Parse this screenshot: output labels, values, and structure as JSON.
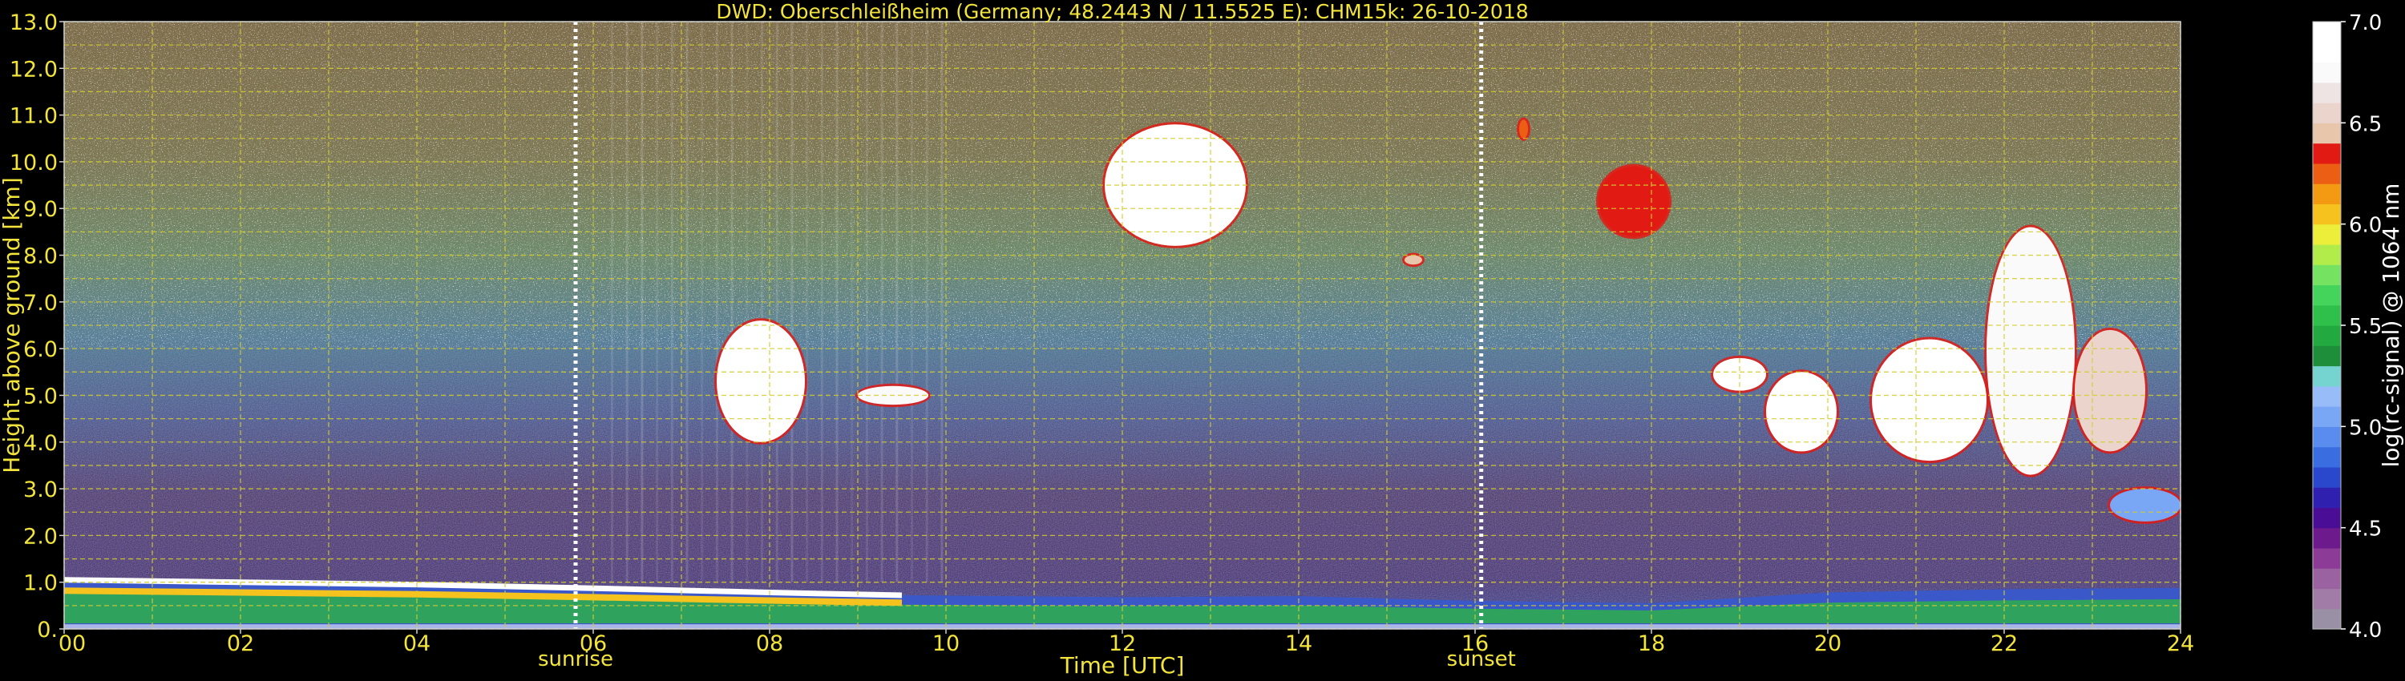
{
  "chart_data": {
    "type": "heatmap",
    "title": "DWD: Oberschleißheim (Germany; 48.2443 N / 11.5525 E):    CHM15k: 26-10-2018",
    "xlabel": "Time [UTC]",
    "ylabel": "Height above ground [km]",
    "colorbar_label": "log(rc-signal) @ 1064 nm",
    "xlim": [
      0,
      24
    ],
    "ylim": [
      0,
      13
    ],
    "x_ticks": [
      {
        "value": 0,
        "label": "00"
      },
      {
        "value": 2,
        "label": "02"
      },
      {
        "value": 4,
        "label": "04"
      },
      {
        "value": 6,
        "label": "06"
      },
      {
        "value": 8,
        "label": "08"
      },
      {
        "value": 10,
        "label": "10"
      },
      {
        "value": 12,
        "label": "12"
      },
      {
        "value": 14,
        "label": "14"
      },
      {
        "value": 16,
        "label": "16"
      },
      {
        "value": 18,
        "label": "18"
      },
      {
        "value": 20,
        "label": "20"
      },
      {
        "value": 22,
        "label": "22"
      },
      {
        "value": 24,
        "label": "24"
      }
    ],
    "y_ticks": [
      {
        "value": 0,
        "label": "0."
      },
      {
        "value": 1,
        "label": "1.0"
      },
      {
        "value": 2,
        "label": "2.0"
      },
      {
        "value": 3,
        "label": "3.0"
      },
      {
        "value": 4,
        "label": "4.0"
      },
      {
        "value": 5,
        "label": "5.0"
      },
      {
        "value": 6,
        "label": "6.0"
      },
      {
        "value": 7,
        "label": "7.0"
      },
      {
        "value": 8,
        "label": "8.0"
      },
      {
        "value": 9,
        "label": "9.0"
      },
      {
        "value": 10,
        "label": "10.0"
      },
      {
        "value": 11,
        "label": "11.0"
      },
      {
        "value": 12,
        "label": "12.0"
      },
      {
        "value": 13,
        "label": "13.0"
      }
    ],
    "x_grid": [
      1,
      3,
      5,
      7,
      9,
      11,
      13,
      15,
      17,
      19,
      21,
      23
    ],
    "y_grid": [
      0.5,
      1.5,
      2.5,
      3.5,
      4.5,
      5.5,
      6.5,
      7.5,
      8.5,
      9.5,
      10.5,
      11.5,
      12.5
    ],
    "grid": true,
    "events": [
      {
        "label": "sunrise",
        "time": 5.8
      },
      {
        "label": "sunset",
        "time": 16.07
      }
    ],
    "colorbar": {
      "vmin": 4.0,
      "vmax": 7.0,
      "ticks": [
        {
          "value": 4.0,
          "label": "4.0"
        },
        {
          "value": 4.5,
          "label": "4.5"
        },
        {
          "value": 5.0,
          "label": "5.0"
        },
        {
          "value": 5.5,
          "label": "5.5"
        },
        {
          "value": 6.0,
          "label": "6.0"
        },
        {
          "value": 6.5,
          "label": "6.5"
        },
        {
          "value": 7.0,
          "label": "7.0"
        }
      ],
      "colors": [
        "#9a90a6",
        "#a07ca6",
        "#9a62a0",
        "#8c3c96",
        "#6c1a8c",
        "#4a0e96",
        "#3020b0",
        "#2a48cc",
        "#3a6ee0",
        "#5a8cf0",
        "#7aa6f6",
        "#98bcf8",
        "#76d4d0",
        "#1e8e3a",
        "#22aa40",
        "#2ec04a",
        "#44d45c",
        "#76e262",
        "#b2ec4a",
        "#ecee3a",
        "#f6c21e",
        "#f49a12",
        "#ec5e14",
        "#e21a14",
        "#e8c6ac",
        "#ead4cc",
        "#efe4e4",
        "#fafafa",
        "#ffffff",
        "#ffffff"
      ]
    },
    "boundary_layer_top_km": [
      [
        0,
        1.05
      ],
      [
        2,
        1.0
      ],
      [
        4,
        0.95
      ],
      [
        5.8,
        0.88
      ],
      [
        8,
        0.78
      ],
      [
        9.5,
        0.72
      ],
      [
        12,
        0.68
      ],
      [
        14,
        0.7
      ],
      [
        16,
        0.6
      ],
      [
        18,
        0.55
      ],
      [
        20,
        0.78
      ],
      [
        22,
        0.85
      ],
      [
        24,
        0.88
      ]
    ],
    "cloud_layers": [
      {
        "time": [
          7.4,
          8.4
        ],
        "base_km": 4.0,
        "top_km": 6.6,
        "value": 6.9
      },
      {
        "time": [
          9.0,
          9.8
        ],
        "base_km": 4.8,
        "top_km": 5.2,
        "value": 6.8
      },
      {
        "time": [
          11.8,
          13.4
        ],
        "base_km": 8.2,
        "top_km": 10.8,
        "value": 6.9
      },
      {
        "time": [
          15.2,
          15.4
        ],
        "base_km": 7.8,
        "top_km": 8.0,
        "value": 6.4
      },
      {
        "time": [
          16.5,
          16.6
        ],
        "base_km": 10.5,
        "top_km": 10.9,
        "value": 6.2
      },
      {
        "time": [
          17.4,
          18.2
        ],
        "base_km": 8.4,
        "top_km": 9.9,
        "value": 6.3
      },
      {
        "time": [
          18.7,
          19.3
        ],
        "base_km": 5.1,
        "top_km": 5.8,
        "value": 6.9
      },
      {
        "time": [
          19.3,
          20.1
        ],
        "base_km": 3.8,
        "top_km": 5.5,
        "value": 6.9
      },
      {
        "time": [
          20.5,
          21.8
        ],
        "base_km": 3.6,
        "top_km": 6.2,
        "value": 6.9
      },
      {
        "time": [
          21.8,
          22.8
        ],
        "base_km": 3.3,
        "top_km": 8.6,
        "value": 6.8
      },
      {
        "time": [
          22.8,
          23.6
        ],
        "base_km": 3.8,
        "top_km": 6.4,
        "value": 6.6
      },
      {
        "time": [
          23.2,
          24.0
        ],
        "base_km": 2.3,
        "top_km": 3.0,
        "value": 5.1
      }
    ]
  }
}
